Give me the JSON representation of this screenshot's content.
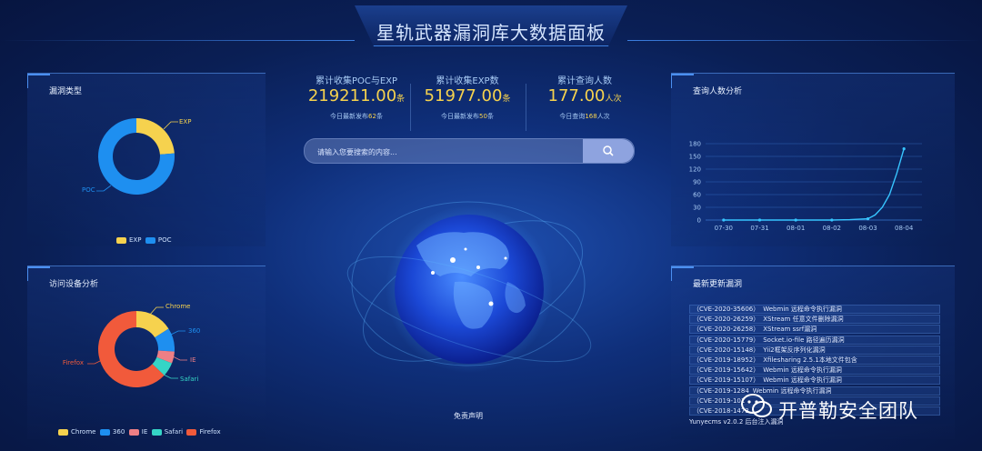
{
  "header": {
    "title": "星轨武器漏洞库大数据面板"
  },
  "stats": [
    {
      "label": "累计收集POC与EXP",
      "value": "219211.00",
      "unit": "条",
      "sub_prefix": "今日最新发布",
      "sub_value": "62",
      "sub_suffix": "条"
    },
    {
      "label": "累计收集EXP数",
      "value": "51977.00",
      "unit": "条",
      "sub_prefix": "今日最新发布",
      "sub_value": "50",
      "sub_suffix": "条"
    },
    {
      "label": "累计查询人数",
      "value": "177.00",
      "unit": "人次",
      "sub_prefix": "今日查询",
      "sub_value": "168",
      "sub_suffix": "人次"
    }
  ],
  "search": {
    "placeholder": "请输入您要搜索的内容..."
  },
  "vuln_type": {
    "title": "漏洞类型",
    "legend": [
      "EXP",
      "POC"
    ],
    "labels": {
      "exp": "EXP",
      "poc": "POC"
    }
  },
  "device": {
    "title": "访问设备分析",
    "legend": [
      "Chrome",
      "360",
      "IE",
      "Safari",
      "Firefox"
    ],
    "labels": {
      "chrome": "Chrome",
      "s360": "360",
      "ie": "IE",
      "safari": "Safari",
      "firefox": "Firefox"
    }
  },
  "query_chart": {
    "title": "查询人数分析"
  },
  "latest": {
    "title": "最新更新漏洞",
    "items": [
      {
        "id": "（CVE-2020-35606）",
        "name": "Webmin 远程命令执行漏洞"
      },
      {
        "id": "（CVE-2020-26259）",
        "name": "XStream 任意文件删除漏洞"
      },
      {
        "id": "（CVE-2020-26258）",
        "name": "XStream ssrf漏洞"
      },
      {
        "id": "（CVE-2020-15779）",
        "name": "Socket.io-file 路径遍历漏洞"
      },
      {
        "id": "（CVE-2020-15148）",
        "name": "Yii2框架反序列化漏洞"
      },
      {
        "id": "（CVE-2019-18952）",
        "name": "Xfilesharing 2.5.1本地文件包含"
      },
      {
        "id": "（CVE-2019-15642）",
        "name": "Webmin 远程命令执行漏洞"
      },
      {
        "id": "（CVE-2019-15107）",
        "name": "Webmin 远程命令执行漏洞"
      },
      {
        "id": "（CVE-2019-1284",
        "name": "Webmin 远程命令执行漏洞"
      },
      {
        "id": "（CVE-2019-101",
        "name": ""
      },
      {
        "id": "（CVE-2018-1473",
        "name": ""
      }
    ],
    "partial": "Yunyecms v2.0.2 后台注入漏洞"
  },
  "footer": {
    "disclaimer": "免责声明"
  },
  "watermark": {
    "text": "开普勒安全团队"
  },
  "colors": {
    "yellow": "#f6d24e",
    "blue": "#1e8ff0",
    "pink": "#ee7f85",
    "teal": "#35d5c6",
    "red": "#f15a3b",
    "line": "#37c5ff"
  },
  "chart_data": [
    {
      "type": "pie",
      "title": "漏洞类型",
      "slices": [
        {
          "label": "EXP",
          "value": 51977
        },
        {
          "label": "POC",
          "value": 167234
        }
      ]
    },
    {
      "type": "pie",
      "title": "访问设备分析",
      "slices": [
        {
          "label": "Chrome",
          "value": 16
        },
        {
          "label": "360",
          "value": 10
        },
        {
          "label": "IE",
          "value": 5
        },
        {
          "label": "Safari",
          "value": 6
        },
        {
          "label": "Firefox",
          "value": 63
        }
      ]
    },
    {
      "type": "line",
      "title": "查询人数分析",
      "categories": [
        "07-30",
        "07-31",
        "08-01",
        "08-02",
        "08-03",
        "08-04"
      ],
      "x": [
        0,
        1,
        2,
        3,
        4,
        5
      ],
      "values": [
        0,
        0,
        0,
        0,
        3,
        168
      ],
      "x_dense": [
        0,
        0.5,
        1,
        1.5,
        2,
        2.5,
        3,
        3.5,
        4,
        4.2,
        4.4,
        4.6,
        4.8,
        5
      ],
      "y_dense": [
        0,
        0,
        0,
        0,
        0,
        0,
        0,
        1,
        3,
        12,
        30,
        60,
        110,
        168
      ],
      "ylim": [
        0,
        180
      ],
      "yticks": [
        0,
        30,
        60,
        90,
        120,
        150,
        180
      ]
    }
  ]
}
